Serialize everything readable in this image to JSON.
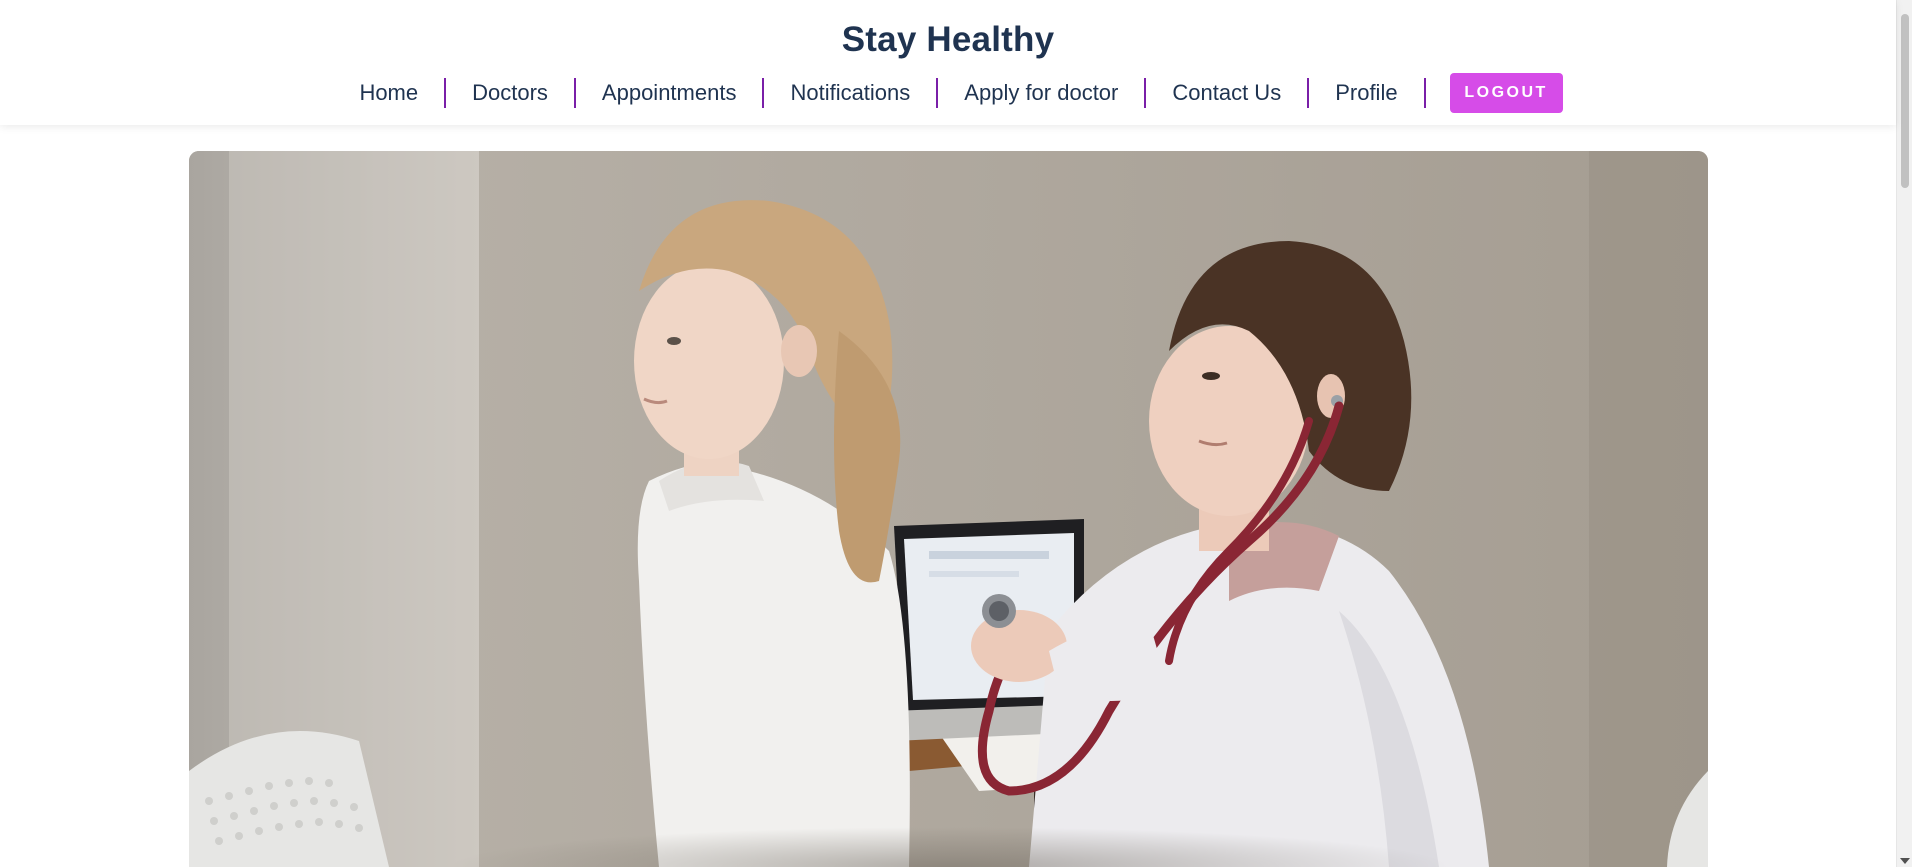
{
  "brand": {
    "title": "Stay Healthy"
  },
  "nav": {
    "items": [
      {
        "label": "Home"
      },
      {
        "label": "Doctors"
      },
      {
        "label": "Appointments"
      },
      {
        "label": "Notifications"
      },
      {
        "label": "Apply for doctor"
      },
      {
        "label": "Contact Us"
      },
      {
        "label": "Profile"
      }
    ],
    "logout_label": "LOGOUT"
  },
  "hero": {
    "image": "doctor-examining-child-photo"
  },
  "colors": {
    "brand_text": "#1f3350",
    "separator": "#7a1fa8",
    "logout_button": "#d64ce8"
  }
}
